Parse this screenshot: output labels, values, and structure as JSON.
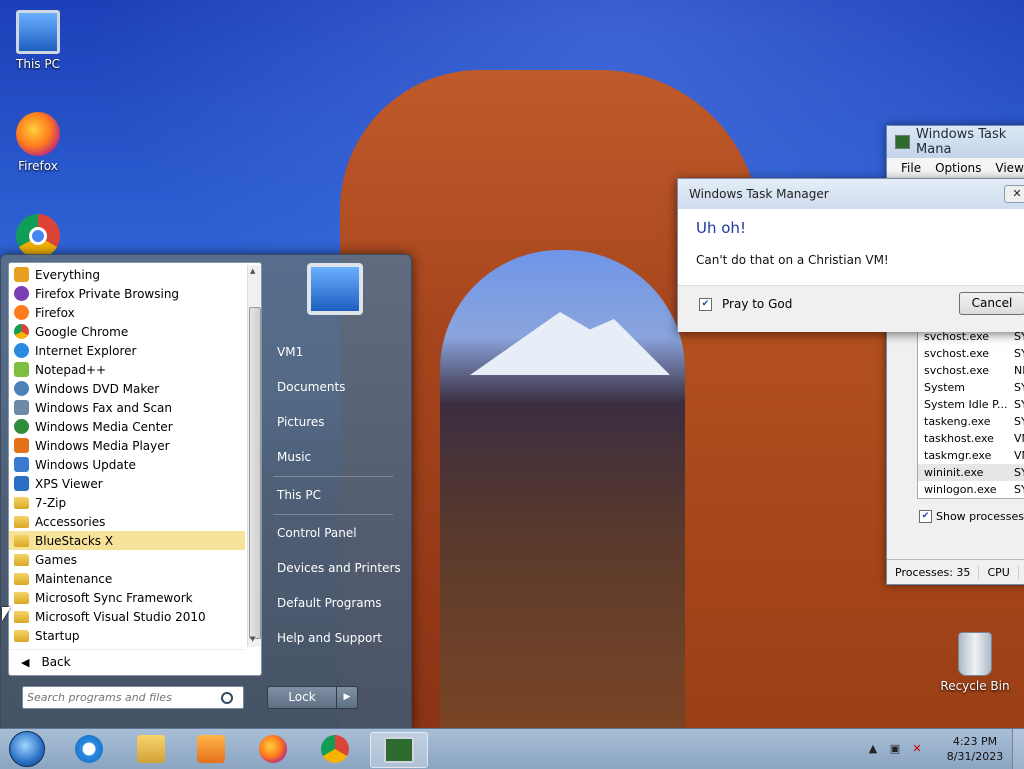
{
  "desktop": {
    "icons": [
      {
        "label": "This PC",
        "icon": "computer-icon"
      },
      {
        "label": "Firefox",
        "icon": "firefox-icon"
      },
      {
        "label": "",
        "icon": "chrome-icon"
      },
      {
        "label": "Recycle Bin",
        "icon": "recycle-bin-icon"
      }
    ]
  },
  "task_manager": {
    "title": "Windows Task Mana",
    "menu": [
      "File",
      "Options",
      "View"
    ],
    "processes": [
      {
        "name": "svchost.exe",
        "user": "SY"
      },
      {
        "name": "svchost.exe",
        "user": "SY"
      },
      {
        "name": "svchost.exe",
        "user": "NE"
      },
      {
        "name": "System",
        "user": "SY"
      },
      {
        "name": "System Idle P...",
        "user": "SY"
      },
      {
        "name": "taskeng.exe",
        "user": "SY"
      },
      {
        "name": "taskhost.exe",
        "user": "VN"
      },
      {
        "name": "taskmgr.exe",
        "user": "VN"
      },
      {
        "name": "wininit.exe",
        "user": "SY"
      },
      {
        "name": "winlogon.exe",
        "user": "SY"
      }
    ],
    "show_processes_label": "Show processes fro",
    "status_processes": "Processes: 35",
    "status_cpu": "CPU"
  },
  "dialog": {
    "title": "Windows Task Manager",
    "close": "✕",
    "heading": "Uh oh!",
    "message": "Can't do that on a Christian VM!",
    "checkbox_label": "Pray to God",
    "checkbox_checked": true,
    "cancel_label": "Cancel"
  },
  "start_menu": {
    "programs": [
      {
        "label": "Everything",
        "color": "#e8a020"
      },
      {
        "label": "Firefox Private Browsing",
        "color": "#7b3fb5"
      },
      {
        "label": "Firefox",
        "color": "#ff7b1c"
      },
      {
        "label": "Google Chrome",
        "color": "#0f9d58"
      },
      {
        "label": "Internet Explorer",
        "color": "#2a8be0"
      },
      {
        "label": "Notepad++",
        "color": "#7fbf3f"
      },
      {
        "label": "Windows DVD Maker",
        "color": "#4d7fb8"
      },
      {
        "label": "Windows Fax and Scan",
        "color": "#6d8aa8"
      },
      {
        "label": "Windows Media Center",
        "color": "#2e8b3a"
      },
      {
        "label": "Windows Media Player",
        "color": "#e5701a"
      },
      {
        "label": "Windows Update",
        "color": "#3a7ad0"
      },
      {
        "label": "XPS Viewer",
        "color": "#2a6fc4"
      }
    ],
    "folders": [
      {
        "label": "7-Zip"
      },
      {
        "label": "Accessories"
      },
      {
        "label": "BlueStacks X",
        "highlight": true
      },
      {
        "label": "Games"
      },
      {
        "label": "Maintenance"
      },
      {
        "label": "Microsoft Sync Framework"
      },
      {
        "label": "Microsoft Visual Studio 2010"
      },
      {
        "label": "Startup"
      }
    ],
    "back_label": "Back",
    "search_placeholder": "Search programs and files",
    "right_links": [
      "VM1",
      "Documents",
      "Pictures",
      "Music",
      "This PC",
      "Control Panel",
      "Devices and Printers",
      "Default Programs",
      "Help and Support"
    ],
    "lock_label": "Lock",
    "lock_arrow": "▶"
  },
  "taskbar": {
    "time": "4:23 PM",
    "date": "8/31/2023"
  }
}
